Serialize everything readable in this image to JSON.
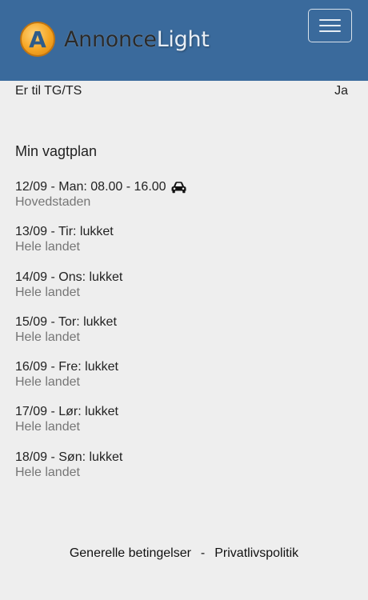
{
  "header": {
    "brand_dark": "Annonce",
    "brand_light": "Light",
    "logo_letter": "A",
    "toggle_icon": "hamburger-menu-icon",
    "colors": {
      "navbar": "#3a6a9c",
      "logo": "#f6a623"
    }
  },
  "info": {
    "label": "Er til TG/TS",
    "value": "Ja"
  },
  "schedule": {
    "title": "Min vagtplan",
    "shifts": [
      {
        "line": "12/09 - Man: 08.00 - 16.00",
        "region": "Hovedstaden",
        "icon": "car-icon"
      },
      {
        "line": "13/09 - Tir: lukket",
        "region": "Hele landet"
      },
      {
        "line": "14/09 - Ons: lukket",
        "region": "Hele landet"
      },
      {
        "line": "15/09 - Tor: lukket",
        "region": "Hele landet"
      },
      {
        "line": "16/09 - Fre: lukket",
        "region": "Hele landet"
      },
      {
        "line": "17/09 - Lør: lukket",
        "region": "Hele landet"
      },
      {
        "line": "18/09 - Søn: lukket",
        "region": "Hele landet"
      }
    ]
  },
  "footer": {
    "terms": "Generelle betingelser",
    "separator": "-",
    "privacy": "Privatlivspolitik"
  }
}
